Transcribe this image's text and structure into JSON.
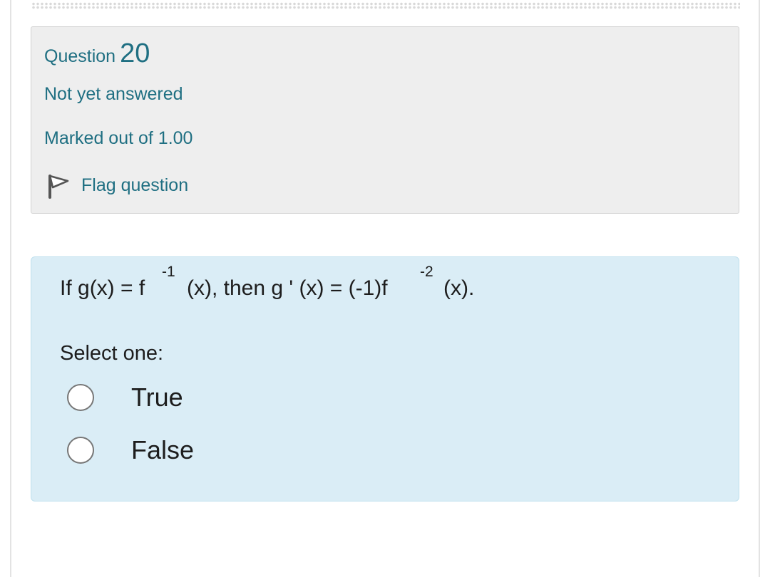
{
  "question_info": {
    "word": "Question",
    "number": "20",
    "state": "Not yet answered",
    "grade": "Marked out of 1.00",
    "flag_label": "Flag question"
  },
  "question": {
    "seg1": "If g(x) = f",
    "sup1": "-1",
    "seg2": "(x), then g ' (x) = (-1)f",
    "sup2": "-2",
    "seg3": "(x).",
    "prompt": "Select one:",
    "options": [
      {
        "label": "True",
        "selected": false
      },
      {
        "label": "False",
        "selected": false
      }
    ]
  },
  "colors": {
    "accent": "#1f6f82",
    "info_background": "#eeeeee",
    "content_background": "#daedf6",
    "text": "#1d1d1d"
  },
  "icons": {
    "flag": "flag-icon",
    "radio": "radio-button-icon"
  }
}
